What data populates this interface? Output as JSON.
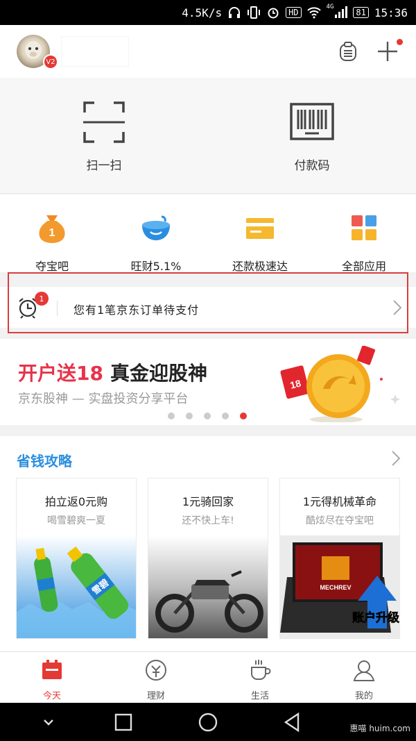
{
  "status_bar": {
    "net_speed": "4.5K/s",
    "battery": "81",
    "time": "15:36",
    "hd_badge": "HD",
    "network": "4G"
  },
  "header": {
    "avatar_badge": "V2",
    "message_icon": "message-clipboard-icon",
    "add_icon": "plus-icon"
  },
  "quick_actions": [
    {
      "label": "扫一扫",
      "icon": "scan-icon"
    },
    {
      "label": "付款码",
      "icon": "barcode-icon"
    }
  ],
  "apps": [
    {
      "label": "夺宝吧",
      "icon": "money-bag-icon",
      "bag_text": "1"
    },
    {
      "label": "旺财5.1%",
      "icon": "bowl-icon"
    },
    {
      "label": "还款极速达",
      "icon": "card-icon"
    },
    {
      "label": "全部应用",
      "icon": "grid-apps-icon"
    }
  ],
  "notice": {
    "count": "1",
    "message": "您有1笔京东订单待支付"
  },
  "banner": {
    "headline_red": "开户送18",
    "headline_black": "真金迎股神",
    "subtitle": "京东股神 — 实盘投资分享平台",
    "envelope_text": "18",
    "active_dot": 4,
    "dot_count": 5
  },
  "savings": {
    "title": "省钱攻略",
    "cards": [
      {
        "title": "拍立返0元购",
        "subtitle": "喝雪碧爽一夏",
        "image_text": "雪碧"
      },
      {
        "title": "1元骑回家",
        "subtitle": "还不快上车!",
        "image_text": ""
      },
      {
        "title": "1元得机械革命",
        "subtitle": "酷炫尽在夺宝吧",
        "image_text": "账户升级",
        "logo_text": "MECHREV"
      }
    ]
  },
  "tabs": [
    {
      "label": "今天",
      "icon": "calendar-icon",
      "active": true
    },
    {
      "label": "理财",
      "icon": "wealth-icon",
      "active": false
    },
    {
      "label": "生活",
      "icon": "coffee-cup-icon",
      "active": false
    },
    {
      "label": "我的",
      "icon": "user-icon",
      "active": false
    }
  ],
  "watermark": "惠喵 huim.com",
  "colors": {
    "accent_red": "#e53935",
    "section_blue": "#2a8ee0",
    "highlight_border": "#d83d3d"
  }
}
